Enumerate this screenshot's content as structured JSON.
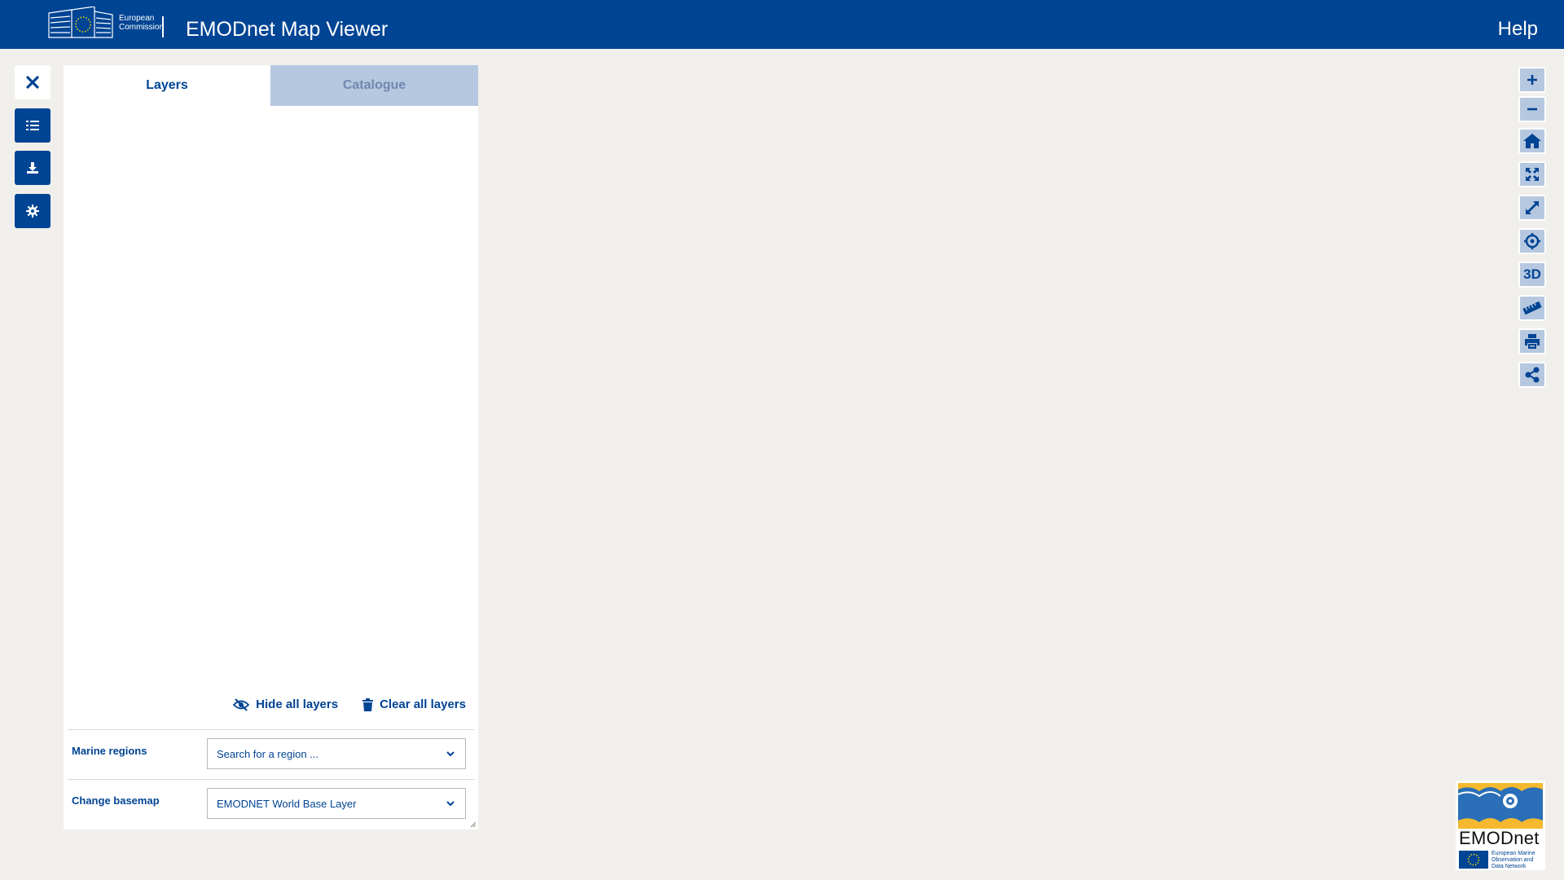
{
  "header": {
    "ec_logo_line1": "European",
    "ec_logo_line2": "Commission",
    "app_title": "EMODnet Map Viewer",
    "help_label": "Help"
  },
  "left_toolbar": {
    "items": [
      {
        "icon": "close-icon"
      },
      {
        "icon": "list-icon"
      },
      {
        "icon": "download-icon"
      },
      {
        "icon": "gear-icon"
      }
    ]
  },
  "panel": {
    "tabs": [
      {
        "label": "Layers",
        "active": true
      },
      {
        "label": "Catalogue",
        "active": false
      }
    ],
    "hide_all_label": "Hide all layers",
    "clear_all_label": "Clear all layers",
    "marine_regions": {
      "label": "Marine regions",
      "placeholder": "Search for a region ..."
    },
    "basemap": {
      "label": "Change basemap",
      "value": "EMODNET World Base Layer"
    }
  },
  "right_toolbar": {
    "items": [
      {
        "icon": "zoom-in-icon"
      },
      {
        "icon": "zoom-out-icon"
      },
      {
        "icon": "home-icon"
      },
      {
        "icon": "zoom-extent-icon"
      },
      {
        "icon": "fullscreen-icon"
      },
      {
        "icon": "locate-icon"
      },
      {
        "icon": "3d-icon",
        "label": "3D"
      },
      {
        "icon": "ruler-icon"
      },
      {
        "icon": "print-icon"
      },
      {
        "icon": "share-icon"
      }
    ]
  },
  "emodnet_logo": {
    "word": "EMODnet",
    "subtitle_line1": "European Marine",
    "subtitle_line2": "Observation and",
    "subtitle_line3": "Data Network"
  },
  "colors": {
    "brand_blue": "#004494",
    "light_blue": "#b6c8e0",
    "map_background": "#f1efeb"
  }
}
